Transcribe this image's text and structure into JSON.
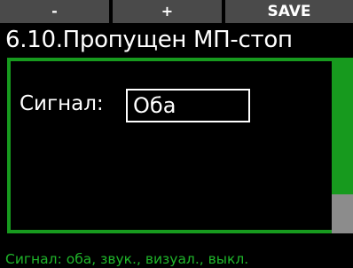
{
  "softkeys": {
    "minus_label": "-",
    "plus_label": "+",
    "save_label": "SAVE"
  },
  "header": {
    "title": "6.10.Пропущен МП-стоп"
  },
  "setting": {
    "label": "Сигнал:",
    "value": "Оба"
  },
  "hint": {
    "text": "Сигнал: оба, звук., визуал., выкл."
  },
  "scrollbar": {
    "position_fraction": 1.0
  },
  "colors": {
    "accent_green": "#179a1e",
    "softkey_bg": "#4a4a4a",
    "scroll_thumb": "#8c8c8c"
  }
}
